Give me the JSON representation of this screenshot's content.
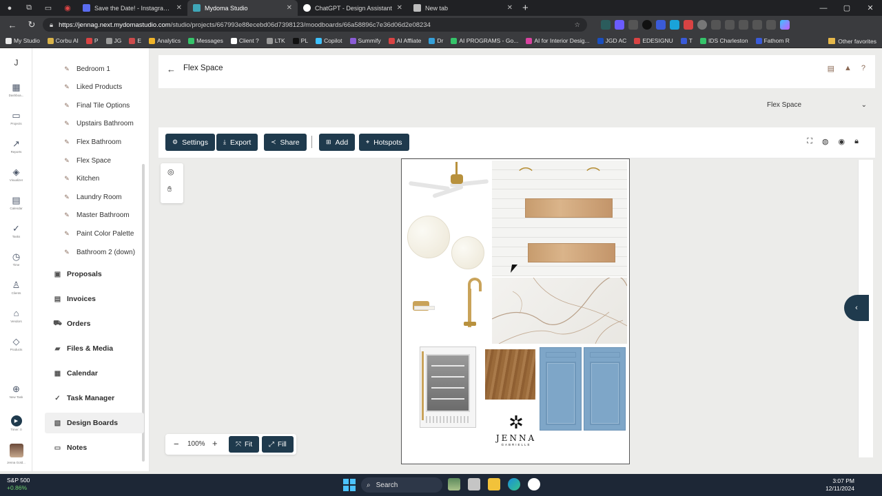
{
  "browser": {
    "tabs": [
      {
        "label": "Save the Date! - Instagram Post -",
        "color": "#5a6cf0"
      },
      {
        "label": "Mydoma Studio",
        "color": "#3fa7b8"
      },
      {
        "label": "ChatGPT - Design Assistant",
        "color": "#ffffff"
      },
      {
        "label": "New tab",
        "color": "#bdbdbd"
      }
    ],
    "url_host": "https://jennag.next.mydomastudio.com",
    "url_path": "/studio/projects/667993e88ecebd06d7398123/moodboards/66a58896c7e36d06d2e08234",
    "bookmarks": [
      "My Studio",
      "Corbu AI",
      "P",
      "JG",
      "E",
      "Analytics",
      "Messages",
      "Client ?",
      "LTK",
      "PL",
      "Copilot",
      "Summify",
      "AI Affliate",
      "Dr",
      "AI PROGRAMS - Go...",
      "AI for Interior Desig...",
      "JGD AC",
      "EDESIGNU",
      "T",
      "IDS Charleston",
      "Fathom R"
    ],
    "other_favorites": "Other favorites"
  },
  "rail": {
    "logo": "J",
    "items": [
      {
        "icon": "dashboard-icon",
        "glyph": "▦",
        "label": "Dashboa..."
      },
      {
        "icon": "folder-icon",
        "glyph": "▭",
        "label": "Projects"
      },
      {
        "icon": "reports-icon",
        "glyph": "↗",
        "label": "Reports"
      },
      {
        "icon": "visualizer-icon",
        "glyph": "◈",
        "label": "Visualizer"
      },
      {
        "icon": "calendar-icon",
        "glyph": "▤",
        "label": "Calendar"
      },
      {
        "icon": "tasks-icon",
        "glyph": "✓",
        "label": "Tasks"
      },
      {
        "icon": "time-icon",
        "glyph": "◷",
        "label": "Time"
      },
      {
        "icon": "clients-icon",
        "glyph": "♙",
        "label": "Clients"
      },
      {
        "icon": "vendors-icon",
        "glyph": "⌂",
        "label": "Vendors"
      },
      {
        "icon": "products-icon",
        "glyph": "◇",
        "label": "Products"
      }
    ],
    "new_task": "New Task",
    "timer": "Timer: 0",
    "user": "Jenna Gold..."
  },
  "sidebar": {
    "boards": [
      "Bedroom 1",
      "Liked Products",
      "Final Tile Options",
      "Upstairs Bathroom",
      "Flex Bathroom",
      "Flex Space",
      "Kitchen",
      "Laundry Room",
      "Master Bathroom",
      "Paint Color Palette",
      "Bathroom 2 (down)"
    ],
    "sections": [
      {
        "label": "Proposals",
        "icon": "proposals-icon",
        "glyph": "▣"
      },
      {
        "label": "Invoices",
        "icon": "invoices-icon",
        "glyph": "▤"
      },
      {
        "label": "Orders",
        "icon": "orders-icon",
        "glyph": "⛟"
      },
      {
        "label": "Files & Media",
        "icon": "files-icon",
        "glyph": "▰"
      },
      {
        "label": "Calendar",
        "icon": "calendar-icon",
        "glyph": "▦"
      },
      {
        "label": "Task Manager",
        "icon": "task-manager-icon",
        "glyph": "✓"
      },
      {
        "label": "Design Boards",
        "icon": "design-boards-icon",
        "glyph": "▧",
        "active": true
      },
      {
        "label": "Notes",
        "icon": "notes-icon",
        "glyph": "▭"
      }
    ]
  },
  "header": {
    "title": "Flex Space"
  },
  "board_select": {
    "value": "Flex Space"
  },
  "toolbar": {
    "settings": "Settings",
    "export": "Export",
    "share": "Share",
    "add": "Add",
    "hotspots": "Hotspots"
  },
  "moodboard": {
    "logo_mark": "✲",
    "logo_name": "JENNA",
    "logo_sub": "GABRIELLE"
  },
  "zoom": {
    "value": "100%",
    "fit": "Fit",
    "fill": "Fill"
  },
  "taskbar": {
    "stock_name": "S&P 500",
    "stock_change": "+0.86%",
    "search": "Search",
    "time": "3:07 PM",
    "date": "12/11/2024"
  },
  "colors": {
    "primary": "#1f3a4d",
    "pin": "#8a6d5e",
    "cabinet": "#7ea6c8"
  }
}
